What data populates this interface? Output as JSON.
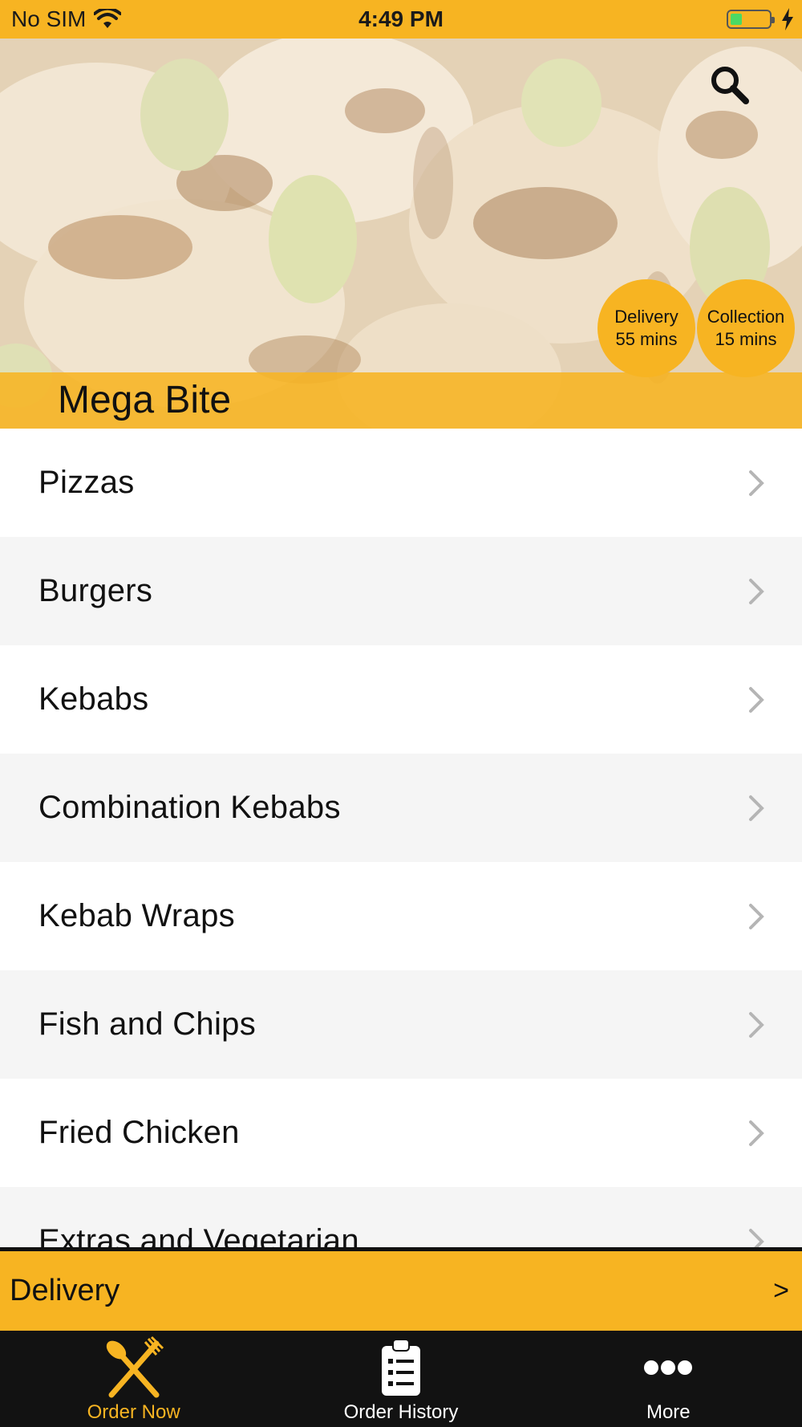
{
  "status_bar": {
    "carrier": "No SIM",
    "time": "4:49 PM",
    "battery_level": 0.3
  },
  "header": {
    "restaurant_name": "Mega Bite",
    "search_icon": "search-icon",
    "delivery_badge": {
      "label": "Delivery",
      "time": "55 mins"
    },
    "collection_badge": {
      "label": "Collection",
      "time": "15 mins"
    }
  },
  "menu": {
    "categories": [
      {
        "label": "Pizzas"
      },
      {
        "label": "Burgers"
      },
      {
        "label": "Kebabs"
      },
      {
        "label": "Combination Kebabs"
      },
      {
        "label": "Kebab Wraps"
      },
      {
        "label": "Fish and Chips"
      },
      {
        "label": "Fried Chicken"
      },
      {
        "label": "Extras and Vegetarian"
      }
    ]
  },
  "delivery_bar": {
    "label": "Delivery",
    "arrow": ">"
  },
  "tabs": [
    {
      "label": "Order Now",
      "icon": "fork-knife-icon",
      "active": true
    },
    {
      "label": "Order History",
      "icon": "clipboard-icon",
      "active": false
    },
    {
      "label": "More",
      "icon": "more-dots-icon",
      "active": false
    }
  ],
  "colors": {
    "accent": "#f7b422",
    "tab_bar_bg": "#121212",
    "row_alt": "#f5f5f5"
  }
}
